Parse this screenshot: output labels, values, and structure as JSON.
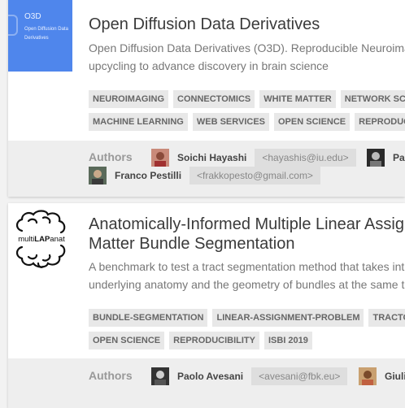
{
  "projects": [
    {
      "thumbnail": {
        "title": "O3D",
        "subtitle": "Open Diffusion Data Derivatives"
      },
      "title": "Open Diffusion Data Derivatives",
      "description_lines": [
        "Open Diffusion Data Derivatives (O3D). Reproducible Neuroima",
        "upcycling to advance discovery in brain science"
      ],
      "tags": [
        "NEUROIMAGING",
        "CONNECTOMICS",
        "WHITE MATTER",
        "NETWORK SCIE",
        "MACHINE LEARNING",
        "WEB SERVICES",
        "OPEN SCIENCE",
        "REPRODUCIBI"
      ],
      "authors_label": "Authors",
      "authors": [
        {
          "name": "Soichi Hayashi",
          "email": "<hayashis@iu.edu>"
        },
        {
          "name": "Pa",
          "email": ""
        },
        {
          "name": "Franco Pestilli",
          "email": "<frakkopesto@gmail.com>"
        }
      ]
    },
    {
      "thumbnail": {
        "logo_text": "multiLAPanat"
      },
      "title_lines": [
        "Anatomically-Informed Multiple Linear Assig",
        "Matter Bundle Segmentation"
      ],
      "description_lines": [
        "A benchmark to test a tract segmentation method that takes int",
        "underlying anatomy and the geometry of bundles at the same ti"
      ],
      "tags": [
        "BUNDLE-SEGMENTATION",
        "LINEAR-ASSIGNMENT-PROBLEM",
        "TRACTOG",
        "OPEN SCIENCE",
        "REPRODUCIBILITY",
        "ISBI 2019"
      ],
      "authors_label": "Authors",
      "authors": [
        {
          "name": "Paolo Avesani",
          "email": "<avesani@fbk.eu>"
        },
        {
          "name": "Giuli",
          "email": ""
        }
      ]
    }
  ]
}
